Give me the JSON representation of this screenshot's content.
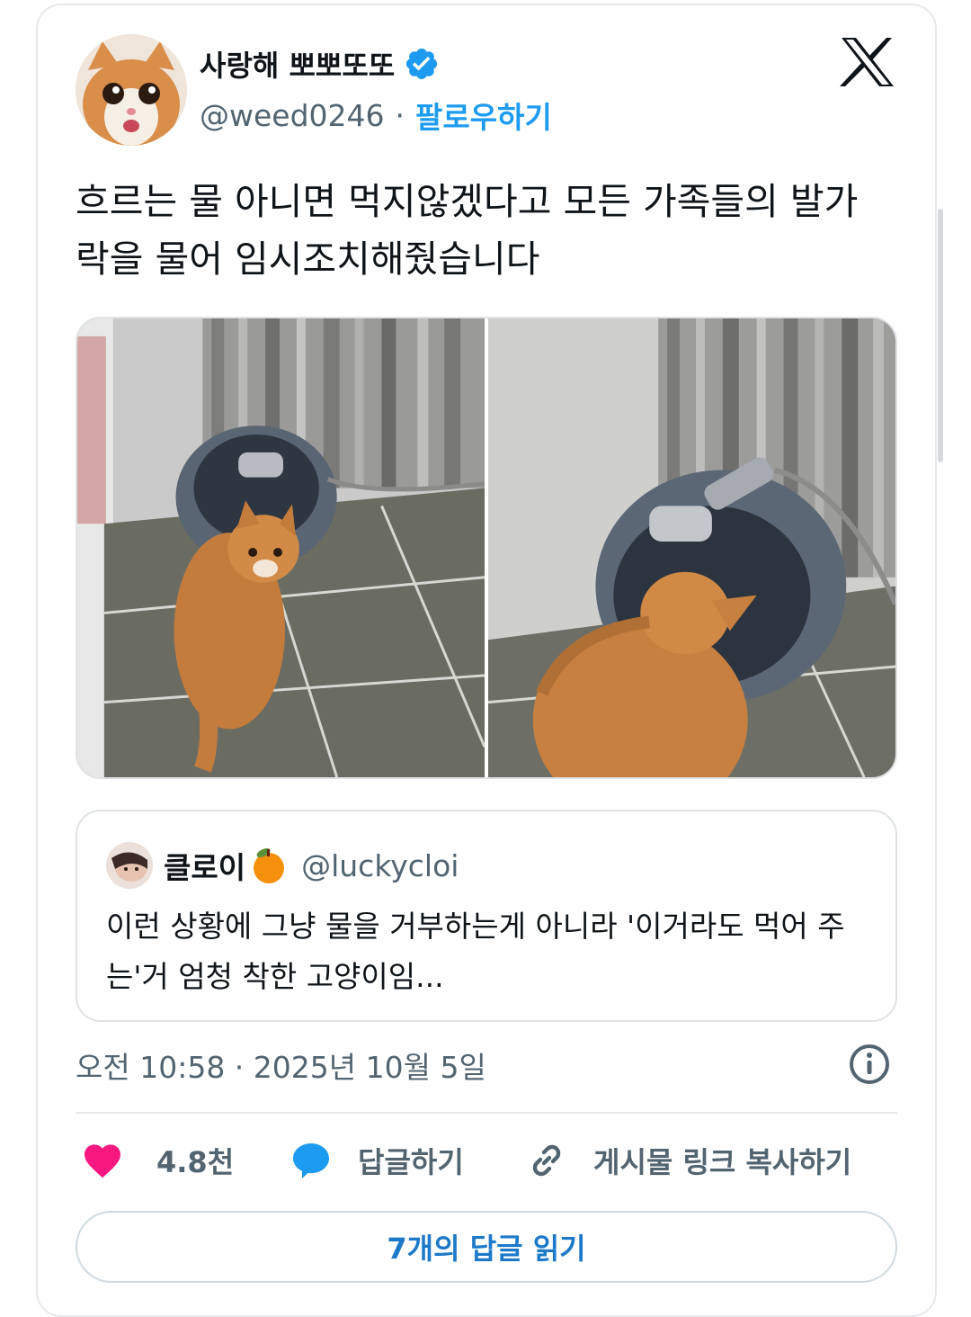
{
  "author": {
    "name": "사랑해 뽀뽀또또",
    "handle": "@weed0246",
    "separator": "·",
    "follow_label": "팔로우하기",
    "verified_icon": "verified-badge-icon"
  },
  "platform_icon": "x-logo-icon",
  "tweet": {
    "text": "흐르는 물 아니면 먹지않겠다고 모든 가족들의 발가락을 물어 임시조치해줬습니다"
  },
  "quote": {
    "name": "클로이",
    "emoji_icon": "orange-emoji-icon",
    "handle": "@luckycloi",
    "text": "이런 상황에 그냥 물을 거부하는게 아니라 '이거라도 먹어 주는'거 엄청 착한 고양이임..."
  },
  "meta": {
    "timestamp": "오전 10:58 · 2025년 10월 5일"
  },
  "actions": {
    "like_count": "4.8천",
    "reply_label": "답글하기",
    "copy_link_label": "게시물 링크 복사하기"
  },
  "read_replies_label": "7개의 답글 읽기",
  "colors": {
    "accent": "#1d9bf0",
    "like": "#f91880",
    "reply": "#1d9bf0",
    "muted": "#536471",
    "border": "#e6e9ec"
  }
}
